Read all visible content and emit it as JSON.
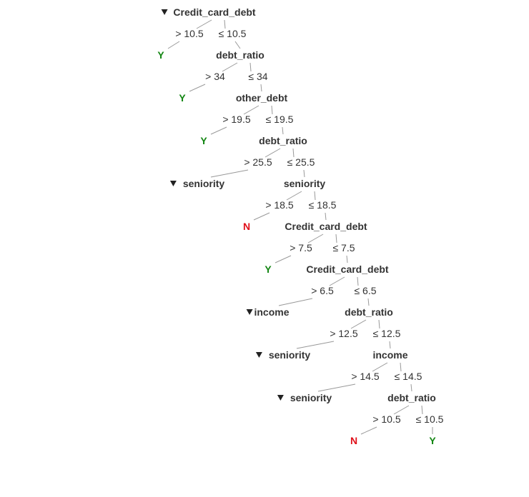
{
  "tree": {
    "colors": {
      "Y": "#138613",
      "N": "#e0101a"
    },
    "nodes": [
      {
        "id": "n1",
        "label": "Credit_card_debt",
        "collapsible": true
      },
      {
        "id": "n2",
        "label": "debt_ratio"
      },
      {
        "id": "n3",
        "label": "other_debt"
      },
      {
        "id": "n4",
        "label": "debt_ratio"
      },
      {
        "id": "n5",
        "label": "seniority",
        "collapsible": true
      },
      {
        "id": "n6",
        "label": "seniority"
      },
      {
        "id": "n7",
        "label": "Credit_card_debt"
      },
      {
        "id": "n8",
        "label": "Credit_card_debt"
      },
      {
        "id": "n9",
        "label": "income",
        "collapsible": true
      },
      {
        "id": "n10",
        "label": "debt_ratio"
      },
      {
        "id": "n11",
        "label": "seniority",
        "collapsible": true
      },
      {
        "id": "n12",
        "label": "income"
      },
      {
        "id": "n13",
        "label": "seniority",
        "collapsible": true
      },
      {
        "id": "n14",
        "label": "debt_ratio"
      }
    ],
    "leaves": [
      {
        "id": "l1",
        "label": "Y"
      },
      {
        "id": "l2",
        "label": "Y"
      },
      {
        "id": "l3",
        "label": "Y"
      },
      {
        "id": "l4",
        "label": "N"
      },
      {
        "id": "l5",
        "label": "Y"
      },
      {
        "id": "l6",
        "label": "N"
      },
      {
        "id": "l7",
        "label": "Y"
      }
    ],
    "edges": [
      {
        "from": "n1",
        "to": "l1",
        "label": "> 10.5"
      },
      {
        "from": "n1",
        "to": "n2",
        "label": "≤ 10.5"
      },
      {
        "from": "n2",
        "to": "l2",
        "label": "> 34"
      },
      {
        "from": "n2",
        "to": "n3",
        "label": "≤ 34"
      },
      {
        "from": "n3",
        "to": "l3",
        "label": "> 19.5"
      },
      {
        "from": "n3",
        "to": "n4",
        "label": "≤ 19.5"
      },
      {
        "from": "n4",
        "to": "n5",
        "label": "> 25.5"
      },
      {
        "from": "n4",
        "to": "n6",
        "label": "≤ 25.5"
      },
      {
        "from": "n6",
        "to": "l4",
        "label": "> 18.5"
      },
      {
        "from": "n6",
        "to": "n7",
        "label": "≤ 18.5"
      },
      {
        "from": "n7",
        "to": "l5",
        "label": "> 7.5"
      },
      {
        "from": "n7",
        "to": "n8",
        "label": "≤ 7.5"
      },
      {
        "from": "n8",
        "to": "n9",
        "label": "> 6.5"
      },
      {
        "from": "n8",
        "to": "n10",
        "label": "≤ 6.5"
      },
      {
        "from": "n10",
        "to": "n11",
        "label": "> 12.5"
      },
      {
        "from": "n10",
        "to": "n12",
        "label": "≤ 12.5"
      },
      {
        "from": "n12",
        "to": "n13",
        "label": "> 14.5"
      },
      {
        "from": "n12",
        "to": "n14",
        "label": "≤ 14.5"
      },
      {
        "from": "n14",
        "to": "l6",
        "label": "> 10.5"
      },
      {
        "from": "n14",
        "to": "l7",
        "label": "≤ 10.5"
      }
    ]
  }
}
